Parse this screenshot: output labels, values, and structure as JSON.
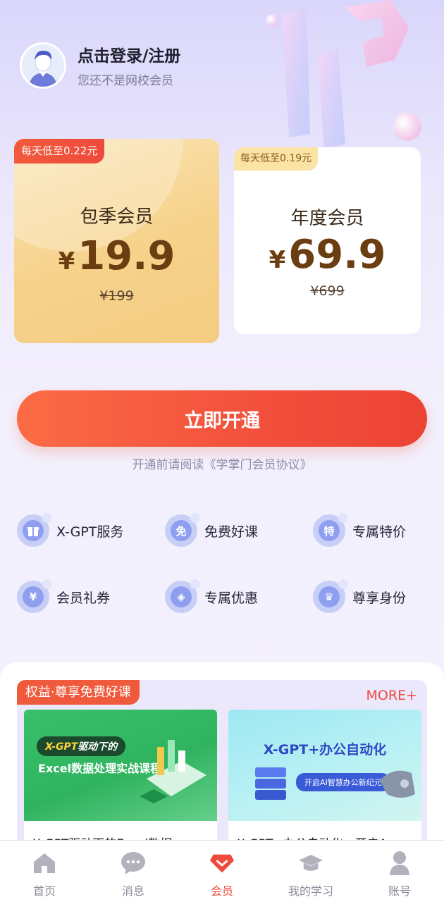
{
  "header": {
    "login_title": "点击登录/注册",
    "login_sub": "您还不是网校会员"
  },
  "plans": [
    {
      "badge": "每天低至0.22元",
      "name": "包季会员",
      "currency": "¥",
      "price": "19.9",
      "original": "¥199",
      "selected": true
    },
    {
      "badge": "每天低至0.19元",
      "name": "年度会员",
      "currency": "¥",
      "price": "69.9",
      "original": "¥699",
      "selected": false
    }
  ],
  "cta": {
    "label": "立即开通"
  },
  "agreement": "开通前请阅读《学掌门会员协议》",
  "benefits": [
    {
      "label": "X-GPT服务",
      "icon": "gift-icon",
      "glyph": "🎁"
    },
    {
      "label": "免费好课",
      "icon": "free-icon",
      "glyph": "免"
    },
    {
      "label": "专属特价",
      "icon": "special-price-icon",
      "glyph": "特"
    },
    {
      "label": "会员礼券",
      "icon": "coupon-icon",
      "glyph": "¥"
    },
    {
      "label": "专属优惠",
      "icon": "tag-icon",
      "glyph": "◈"
    },
    {
      "label": "尊享身份",
      "icon": "crown-icon",
      "glyph": "♛"
    }
  ],
  "courses_section": {
    "tag": "权益·尊享免费好课",
    "more": "MORE+",
    "items": [
      {
        "cover_line1_a": "X-GPT",
        "cover_line1_b": "驱动下的",
        "cover_line2": "Excel数据处理实战课程",
        "title": "X-GPT驱动下的Excel数据"
      },
      {
        "cover_title": "X-GPT+办公自动化",
        "cover_sub": "开启AI智慧办公新纪元",
        "title": "X-GPT+办公自动化：开启A"
      }
    ]
  },
  "nav": [
    {
      "label": "首页",
      "icon": "home-icon",
      "active": false
    },
    {
      "label": "消息",
      "icon": "message-icon",
      "active": false
    },
    {
      "label": "会员",
      "icon": "vip-diamond-icon",
      "active": true
    },
    {
      "label": "我的学习",
      "icon": "graduation-cap-icon",
      "active": false
    },
    {
      "label": "账号",
      "icon": "user-icon",
      "active": false
    }
  ],
  "colors": {
    "accent": "#ef4b3c",
    "gold": "#f6d28b",
    "benefit_icon": "#8f9ff0"
  }
}
